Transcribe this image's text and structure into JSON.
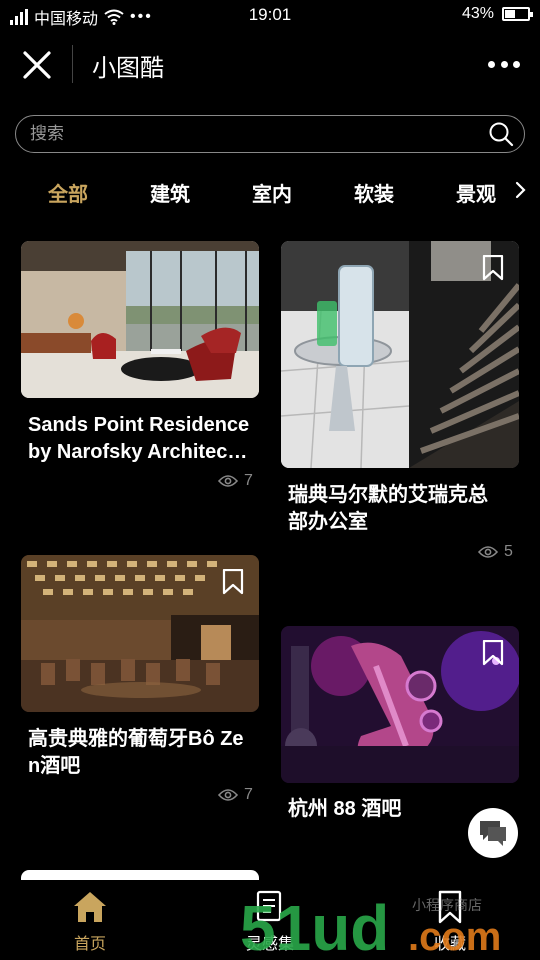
{
  "status_bar": {
    "carrier": "中国移动",
    "time": "19:01",
    "battery_percent": "43%",
    "battery_level": 0.43
  },
  "header": {
    "title": "小图酷"
  },
  "search": {
    "placeholder": "搜索"
  },
  "tabs": [
    {
      "label": "全部",
      "active": true
    },
    {
      "label": "建筑",
      "active": false
    },
    {
      "label": "室内",
      "active": false
    },
    {
      "label": "软装",
      "active": false
    },
    {
      "label": "景观",
      "active": false
    }
  ],
  "cards": [
    {
      "title_line1": "Sands Point Residence",
      "title_line2": "by Narofsky Architec…",
      "views": "7"
    },
    {
      "title_line1": "瑞典马尔默的艾瑞克总",
      "title_line2": "部办公室",
      "views": "5"
    },
    {
      "title_line1": "高贵典雅的葡萄牙Bô Ze",
      "title_line2": "n酒吧",
      "views": "7"
    },
    {
      "title_line1": "杭州 88 酒吧",
      "title_line2": ""
    }
  ],
  "bottom_nav": [
    {
      "label": "首页",
      "icon": "home-icon",
      "active": true
    },
    {
      "label": "灵感集",
      "icon": "inspiration-icon",
      "active": false
    },
    {
      "label": "收藏",
      "icon": "bookmark-icon",
      "active": false
    }
  ],
  "watermark": {
    "text_main": "51ud.com",
    "text_side": "小程序商店"
  },
  "colors": {
    "accent": "#c9a55e",
    "background": "#000000",
    "muted": "#888888",
    "watermark_green": "#2aa84a",
    "watermark_orange": "#e07a1a"
  }
}
